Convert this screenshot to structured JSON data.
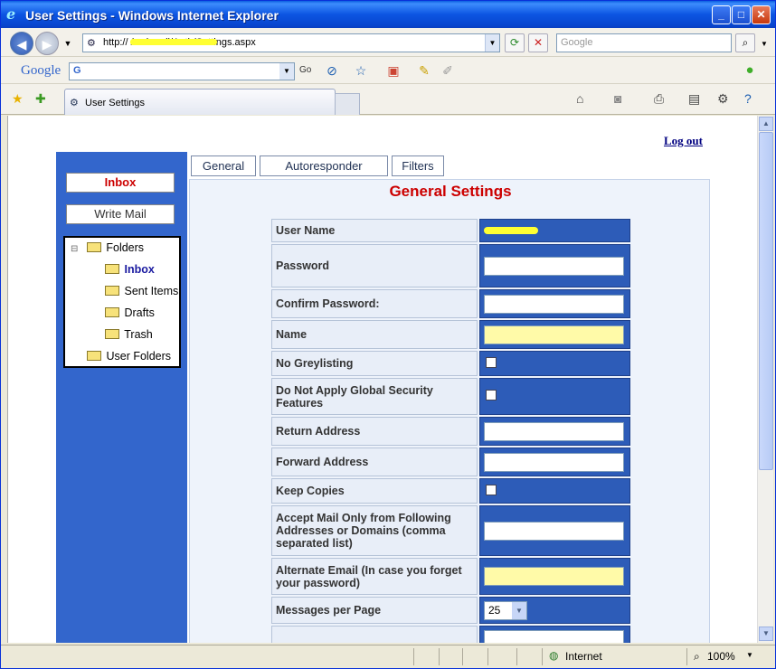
{
  "window": {
    "title": "User Settings - Windows Internet Explorer",
    "minimize": "_",
    "maximize": "□",
    "close": "✕"
  },
  "address": {
    "url": "http://                   /webmail/Auth/Settings.aspx",
    "search_placeholder": "Google",
    "icons": [
      "back-icon",
      "forward-icon",
      "refresh-icon",
      "stop-icon",
      "search-icon"
    ]
  },
  "google_toolbar": {
    "logo": "Google",
    "select_value": "G",
    "go_label": "Go"
  },
  "tabs": {
    "active_label": "User Settings"
  },
  "page": {
    "logout": "Log out",
    "sidebar": {
      "inbox": "Inbox",
      "write_mail": "Write Mail",
      "folders": "Folders",
      "folder_items": [
        "Inbox",
        "Sent Items",
        "Drafts",
        "Trash"
      ],
      "user_folders": "User Folders"
    },
    "settings_tabs": [
      "General",
      "Autoresponder",
      "Filters"
    ],
    "panel_title": "General Settings",
    "rows": [
      {
        "label": "User Name",
        "type": "text",
        "value": "******"
      },
      {
        "label": "Password",
        "type": "input",
        "value": ""
      },
      {
        "label": "Confirm Password:",
        "type": "input",
        "value": ""
      },
      {
        "label": "Name",
        "type": "input-yellow",
        "value": ""
      },
      {
        "label": "No Greylisting",
        "type": "checkbox",
        "checked": false
      },
      {
        "label": "Do Not Apply Global Security Features",
        "type": "checkbox",
        "checked": false
      },
      {
        "label": "Return Address",
        "type": "input",
        "value": ""
      },
      {
        "label": "Forward Address",
        "type": "input",
        "value": ""
      },
      {
        "label": "Keep Copies",
        "type": "checkbox",
        "checked": false
      },
      {
        "label": "Accept Mail Only from Following Addresses or Domains (comma separated list)",
        "type": "input",
        "value": ""
      },
      {
        "label": "Alternate Email (In case you forget your password)",
        "type": "input-yellow",
        "value": ""
      },
      {
        "label": "Messages per Page",
        "type": "select",
        "value": "25"
      }
    ]
  },
  "status": {
    "zone": "Internet",
    "zoom": "100%"
  }
}
